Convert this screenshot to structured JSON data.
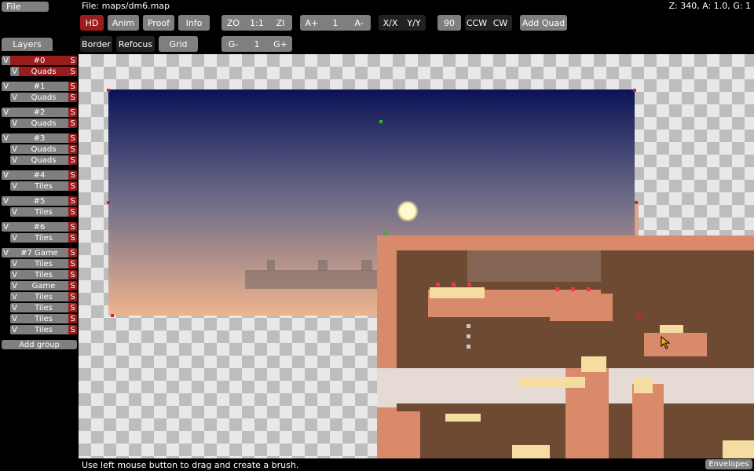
{
  "topbar": {
    "file_label": "File",
    "file_path": "File: maps/dm6.map",
    "zoom_info": "Z: 340, A: 1.0, G: 1"
  },
  "toolbar": {
    "hd": "HD",
    "anim": "Anim",
    "proof": "Proof",
    "info": "Info",
    "zo": "ZO",
    "z11": "1:1",
    "zi": "ZI",
    "a_plus": "A+",
    "a_val": "1",
    "a_minus": "A-",
    "xx": "X/X",
    "yy": "Y/Y",
    "rot": "90",
    "ccw": "CCW",
    "cw": "CW",
    "add_quad": "Add Quad",
    "border": "Border",
    "refocus": "Refocus",
    "grid": "Grid",
    "g_minus": "G-",
    "g_val": "1",
    "g_plus": "G+"
  },
  "sidebar": {
    "tab": "Layers",
    "v": "V",
    "s": "S",
    "add_group": "Add group",
    "groups": [
      {
        "name": "#0",
        "layers": [
          "Quads"
        ]
      },
      {
        "name": "#1",
        "layers": [
          "Quads"
        ]
      },
      {
        "name": "#2",
        "layers": [
          "Quads"
        ]
      },
      {
        "name": "#3",
        "layers": [
          "Quads",
          "Quads"
        ]
      },
      {
        "name": "#4",
        "layers": [
          "Tiles"
        ]
      },
      {
        "name": "#5",
        "layers": [
          "Tiles"
        ]
      },
      {
        "name": "#6",
        "layers": [
          "Tiles"
        ]
      },
      {
        "name": "#7 Game",
        "layers": [
          "Tiles",
          "Tiles",
          "Game",
          "Tiles",
          "Tiles",
          "Tiles",
          "Tiles"
        ]
      }
    ]
  },
  "status": {
    "text": "Use left mouse button to drag and create a brush.",
    "envelopes": "Envelopes"
  },
  "colors": {
    "accent_red": "#9b1c1c",
    "button_gray": "#7f7f7f",
    "sky_top": "#0b1256",
    "sky_bottom": "#f0b48e",
    "terrain": "#d98a6a",
    "terrain_dark": "#6e4a32"
  }
}
